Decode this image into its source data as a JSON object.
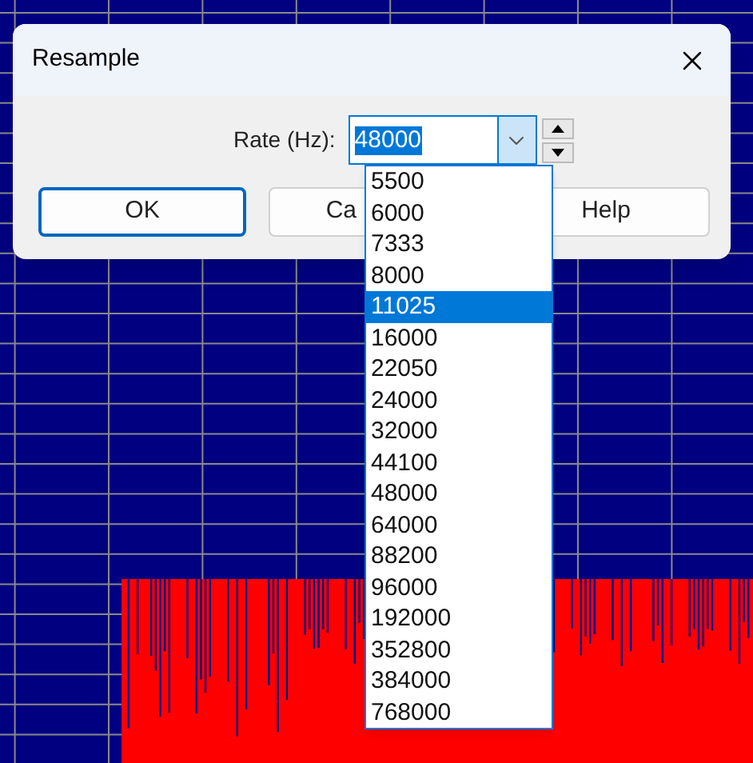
{
  "dialog": {
    "title": "Resample",
    "rate_label": "Rate (Hz):",
    "rate_value": "48000",
    "buttons": [
      {
        "label": "OK",
        "default": true
      },
      {
        "label": "Ca",
        "default": false
      },
      {
        "label": "Help",
        "default": false
      }
    ]
  },
  "dropdown": {
    "options": [
      {
        "label": "5500",
        "selected": false
      },
      {
        "label": "6000",
        "selected": false
      },
      {
        "label": "7333",
        "selected": false
      },
      {
        "label": "8000",
        "selected": false
      },
      {
        "label": "11025",
        "selected": true
      },
      {
        "label": "16000",
        "selected": false
      },
      {
        "label": "22050",
        "selected": false
      },
      {
        "label": "24000",
        "selected": false
      },
      {
        "label": "32000",
        "selected": false
      },
      {
        "label": "44100",
        "selected": false
      },
      {
        "label": "48000",
        "selected": false
      },
      {
        "label": "64000",
        "selected": false
      },
      {
        "label": "88200",
        "selected": false
      },
      {
        "label": "96000",
        "selected": false
      },
      {
        "label": "192000",
        "selected": false
      },
      {
        "label": "352800",
        "selected": false
      },
      {
        "label": "384000",
        "selected": false
      },
      {
        "label": "768000",
        "selected": false
      }
    ]
  }
}
